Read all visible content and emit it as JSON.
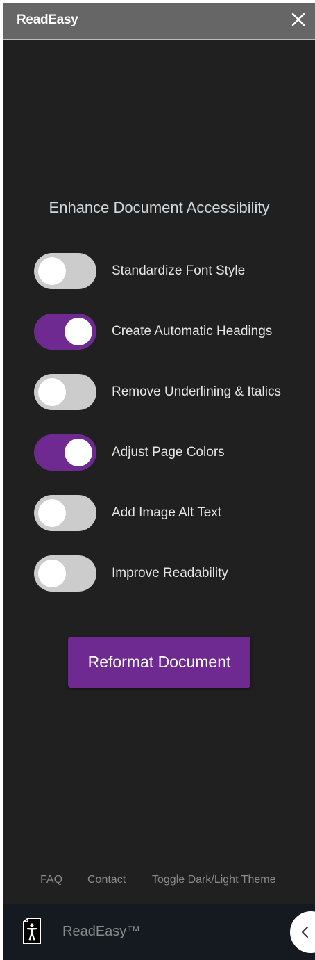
{
  "header": {
    "title": "ReadEasy"
  },
  "main": {
    "title": "Enhance Document Accessibility",
    "options": [
      {
        "label": "Standardize Font Style",
        "enabled": false
      },
      {
        "label": "Create Automatic Headings",
        "enabled": true
      },
      {
        "label": "Remove Underlining & Italics",
        "enabled": false
      },
      {
        "label": "Adjust Page Colors",
        "enabled": true
      },
      {
        "label": "Add Image Alt Text",
        "enabled": false
      },
      {
        "label": "Improve Readability",
        "enabled": false
      }
    ],
    "primary_button": "Reformat Document"
  },
  "footer": {
    "links": [
      "FAQ",
      "Contact",
      "Toggle Dark/Light Theme"
    ]
  },
  "bottom_bar": {
    "brand": "ReadEasy™"
  },
  "colors": {
    "accent": "#6f2a91",
    "panel_bg": "#202020",
    "header_bg": "#666666",
    "toggle_off": "#cccccc"
  },
  "icons": {
    "close": "close-icon",
    "accessibility": "accessibility-document-icon",
    "collapse": "chevron-left-icon"
  }
}
